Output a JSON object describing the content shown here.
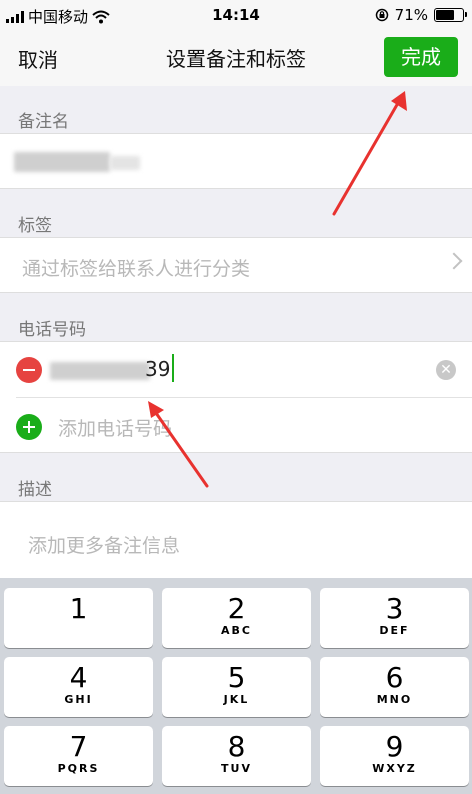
{
  "status_bar": {
    "carrier": "中国移动",
    "time": "14:14",
    "battery_percent": "71%",
    "battery_level": 0.71
  },
  "navbar": {
    "cancel_label": "取消",
    "title": "设置备注和标签",
    "done_label": "完成",
    "accent_color": "#1aad19"
  },
  "remark": {
    "section_label": "备注名"
  },
  "tags": {
    "section_label": "标签",
    "placeholder": "通过标签给联系人进行分类"
  },
  "phone": {
    "section_label": "电话号码",
    "visible_suffix": "39",
    "add_label": "添加电话号码"
  },
  "description": {
    "section_label": "描述",
    "placeholder": "添加更多备注信息"
  },
  "keypad": {
    "keys": [
      {
        "num": "1",
        "letters": ""
      },
      {
        "num": "2",
        "letters": "ABC"
      },
      {
        "num": "3",
        "letters": "DEF"
      },
      {
        "num": "4",
        "letters": "GHI"
      },
      {
        "num": "5",
        "letters": "JKL"
      },
      {
        "num": "6",
        "letters": "MNO"
      },
      {
        "num": "7",
        "letters": "PQRS"
      },
      {
        "num": "8",
        "letters": "TUV"
      },
      {
        "num": "9",
        "letters": "WXYZ"
      }
    ]
  }
}
